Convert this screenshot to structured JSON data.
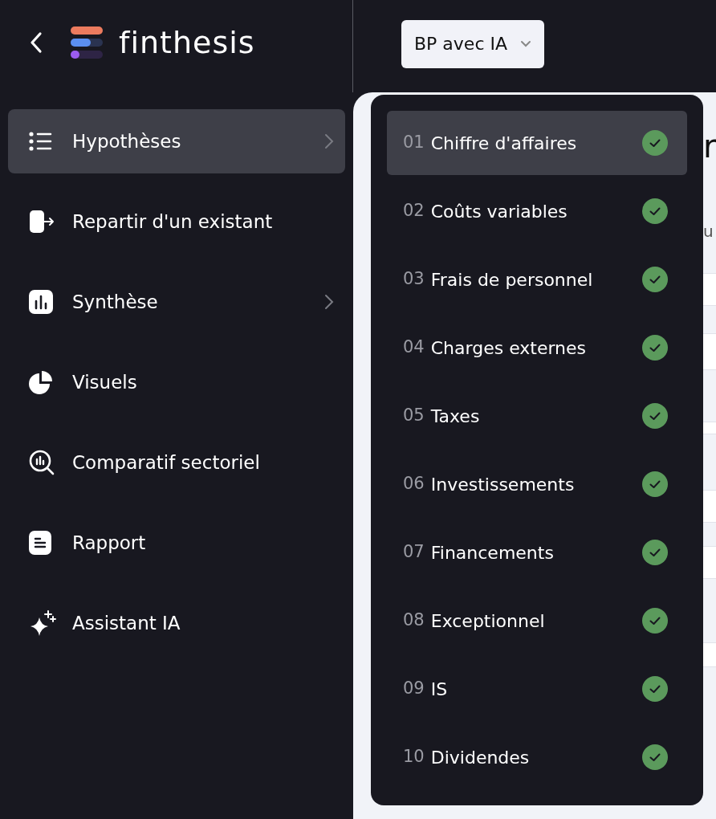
{
  "brand": {
    "name": "finthesis"
  },
  "project_selector": {
    "label": "BP avec IA"
  },
  "sidebar": {
    "items": [
      {
        "label": "Hypothèses",
        "selected": true,
        "has_submenu": true
      },
      {
        "label": "Repartir d'un existant",
        "selected": false,
        "has_submenu": false
      },
      {
        "label": "Synthèse",
        "selected": false,
        "has_submenu": true
      },
      {
        "label": "Visuels",
        "selected": false,
        "has_submenu": false
      },
      {
        "label": "Comparatif sectoriel",
        "selected": false,
        "has_submenu": false
      },
      {
        "label": "Rapport",
        "selected": false,
        "has_submenu": false
      },
      {
        "label": "Assistant IA",
        "selected": false,
        "has_submenu": false
      }
    ]
  },
  "submenu": {
    "items": [
      {
        "number": "01",
        "label": "Chiffre d'affaires",
        "selected": true,
        "done": true
      },
      {
        "number": "02",
        "label": "Coûts variables",
        "selected": false,
        "done": true
      },
      {
        "number": "03",
        "label": "Frais de personnel",
        "selected": false,
        "done": true
      },
      {
        "number": "04",
        "label": "Charges externes",
        "selected": false,
        "done": true
      },
      {
        "number": "05",
        "label": "Taxes",
        "selected": false,
        "done": true
      },
      {
        "number": "06",
        "label": "Investissements",
        "selected": false,
        "done": true
      },
      {
        "number": "07",
        "label": "Financements",
        "selected": false,
        "done": true
      },
      {
        "number": "08",
        "label": "Exceptionnel",
        "selected": false,
        "done": true
      },
      {
        "number": "09",
        "label": "IS",
        "selected": false,
        "done": true
      },
      {
        "number": "10",
        "label": "Dividendes",
        "selected": false,
        "done": true
      }
    ]
  },
  "background_content": {
    "heading_fragment": "r",
    "subtitle_fragment": "u"
  }
}
